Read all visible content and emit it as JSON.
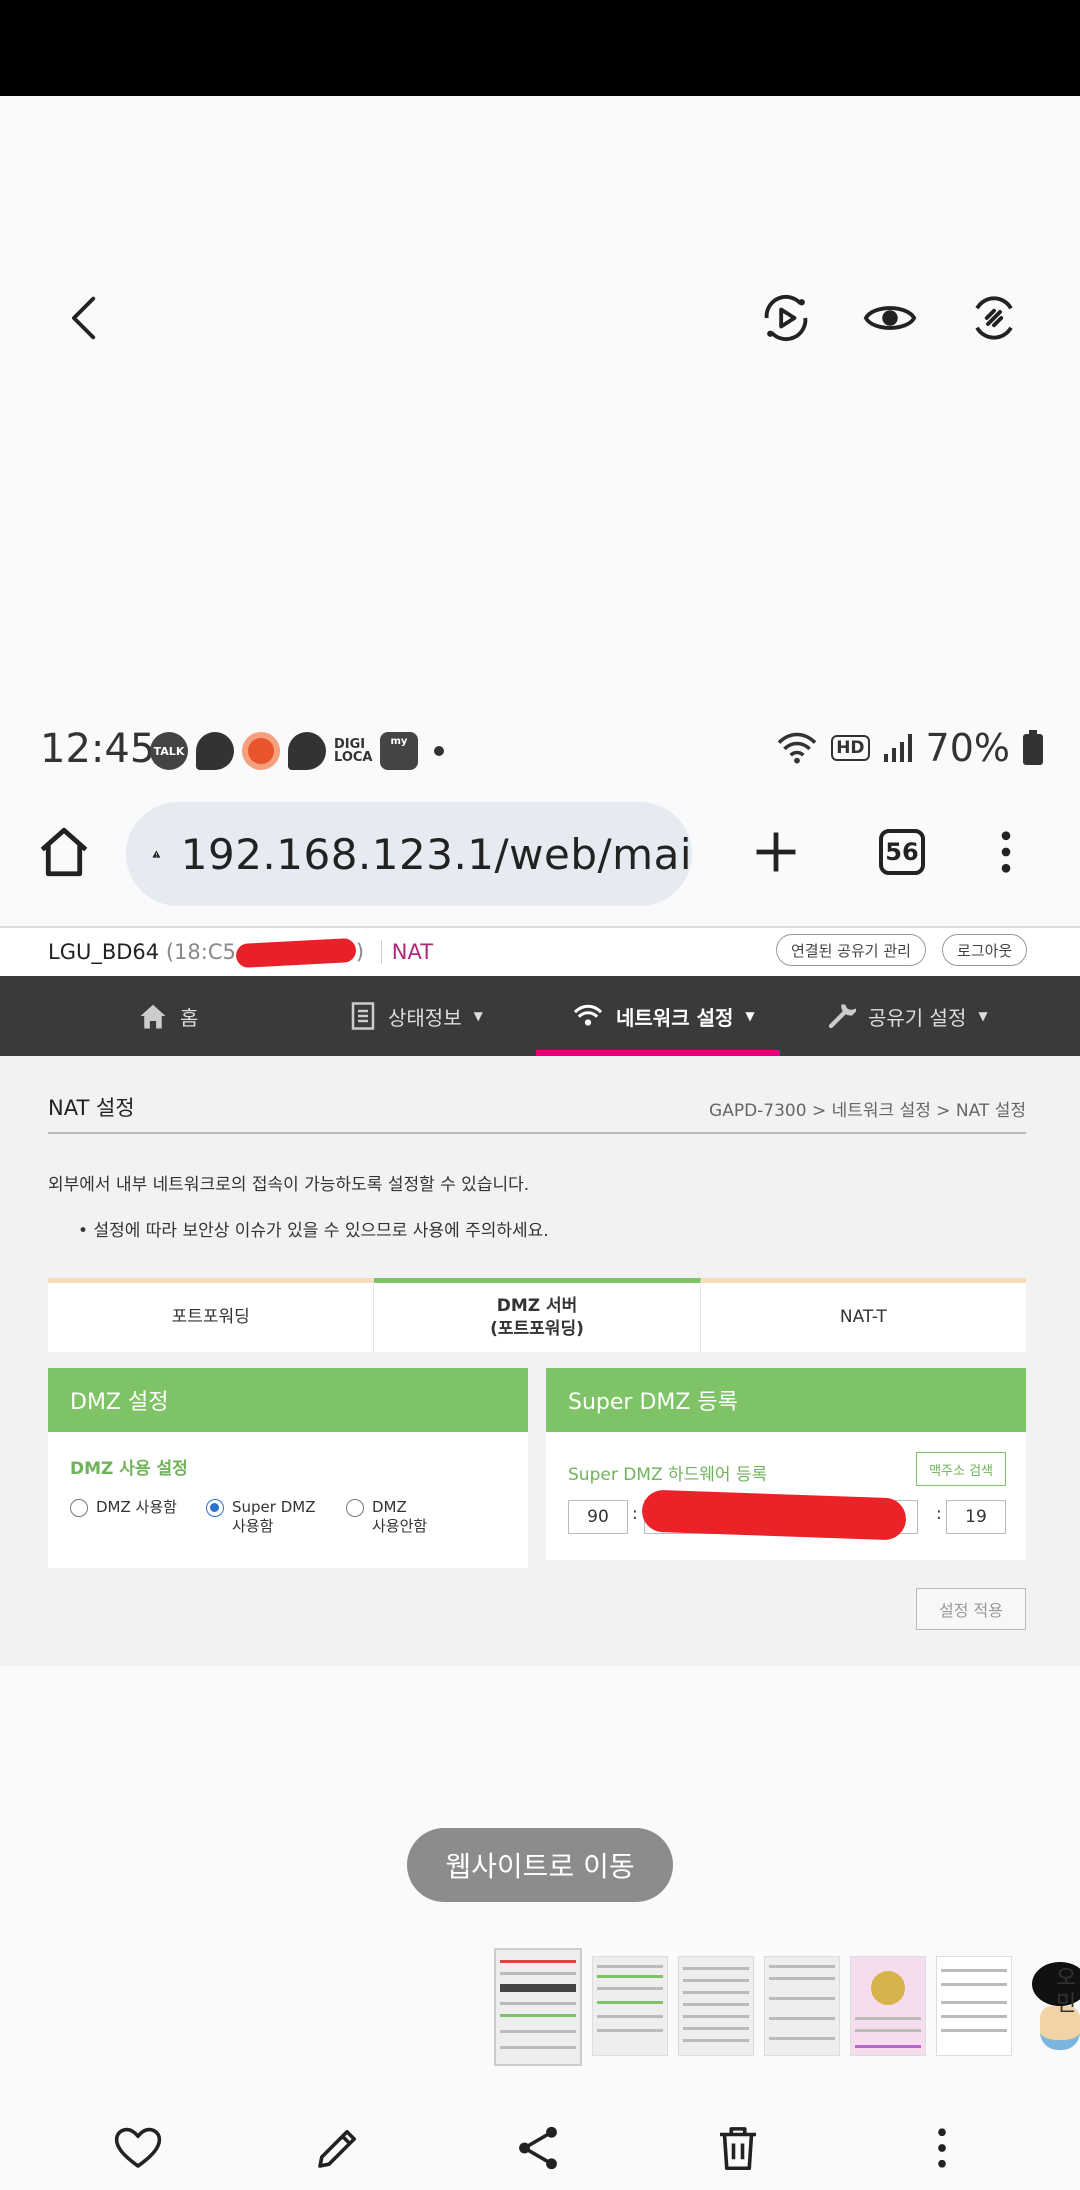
{
  "statusbar": {
    "time": "12:45",
    "notif_talk": "TALK",
    "notif_digi": "DIGI LOCA",
    "notif_myhome": "my",
    "battery": "70%",
    "hd": "HD"
  },
  "browser": {
    "url": "192.168.123.1/web/mai",
    "tab_count": "56"
  },
  "router": {
    "device_name": "LGU_BD64",
    "device_mac_prefix": "(18:C5",
    "device_mac_suffix": ")",
    "mode": "NAT",
    "btn_manage": "연결된 공유기 관리",
    "btn_logout": "로그아웃",
    "nav": {
      "home": "홈",
      "status": "상태정보",
      "network": "네트워크 설정",
      "device": "공유기 설정"
    },
    "page_title": "NAT 설정",
    "breadcrumb": "GAPD-7300 > 네트워크 설정 > NAT 설정",
    "description": "외부에서 내부 네트워크로의 접속이 가능하도록 설정할 수 있습니다.",
    "note": "설정에 따라 보안상 이슈가 있을 수 있으므로 사용에 주의하세요.",
    "tabs": {
      "port_forwarding": "포트포워딩",
      "dmz_line1": "DMZ 서버",
      "dmz_line2": "(포트포워딩)",
      "nat_t": "NAT-T"
    },
    "dmz_panel": {
      "title": "DMZ 설정",
      "subtitle": "DMZ 사용 설정",
      "opt1": "DMZ 사용함",
      "opt2_line1": "Super DMZ",
      "opt2_line2": "사용함",
      "opt3_line1": "DMZ",
      "opt3_line2": "사용안함",
      "selected": "opt2"
    },
    "super_panel": {
      "title": "Super DMZ 등록",
      "subtitle": "Super DMZ 하드웨어 등록",
      "mac_search": "맥주소 검색",
      "mac_first": "90",
      "mac_last": "19"
    },
    "apply": "설정 적용"
  },
  "viewer": {
    "go_website": "웹사이트로 이동",
    "side_letters": "오 민"
  },
  "colors": {
    "accent_green": "#7ec466",
    "nav_underline": "#e6007e",
    "nav_bg": "#3a3a3a"
  }
}
